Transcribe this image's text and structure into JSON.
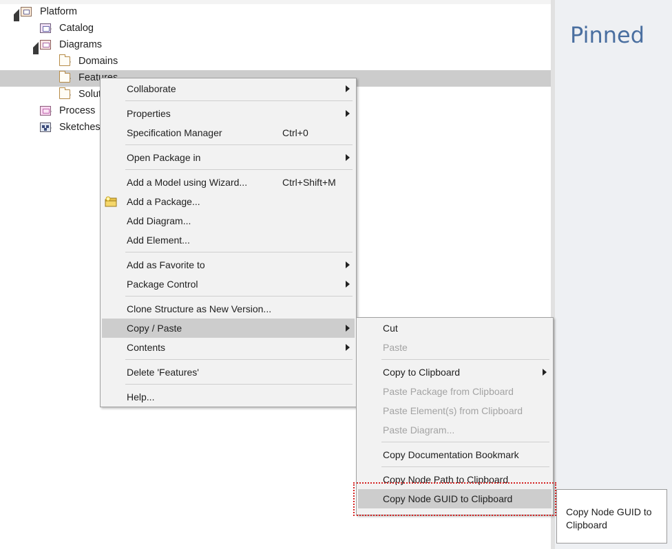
{
  "tree": {
    "items": [
      {
        "label": "Platform",
        "twisty": "open",
        "icon": "package-icon",
        "level": 0,
        "selected": false
      },
      {
        "label": "Catalog",
        "twisty": "closed",
        "icon": "catalog-package-icon",
        "level": 1,
        "selected": false
      },
      {
        "label": "Diagrams",
        "twisty": "open",
        "icon": "diagram-package-icon",
        "level": 1,
        "selected": false
      },
      {
        "label": "Domains",
        "twisty": "closed",
        "icon": "folder-icon",
        "level": 2,
        "selected": false
      },
      {
        "label": "Features",
        "twisty": "closed",
        "icon": "folder-icon",
        "level": 2,
        "selected": true
      },
      {
        "label": "Solutions",
        "twisty": "closed",
        "icon": "folder-icon",
        "level": 2,
        "selected": false
      },
      {
        "label": "Process",
        "twisty": "closed",
        "icon": "process-package-icon",
        "level": 1,
        "selected": false
      },
      {
        "label": "Sketches",
        "twisty": "closed",
        "icon": "sketch-package-icon",
        "level": 1,
        "selected": false
      }
    ]
  },
  "pinned": {
    "title": "Pinned"
  },
  "context_menu": {
    "items": [
      {
        "label": "Collaborate",
        "submenu": true
      },
      {
        "separator": true
      },
      {
        "label": "Properties",
        "submenu": true
      },
      {
        "label": "Specification Manager",
        "shortcut": "Ctrl+0"
      },
      {
        "separator": true
      },
      {
        "label": "Open Package in",
        "submenu": true
      },
      {
        "separator": true
      },
      {
        "label": "Add a Model using Wizard...",
        "shortcut": "Ctrl+Shift+M"
      },
      {
        "label": "Add a Package...",
        "icon": "add-package-icon"
      },
      {
        "label": "Add Diagram..."
      },
      {
        "label": "Add Element..."
      },
      {
        "separator": true
      },
      {
        "label": "Add as Favorite to",
        "submenu": true
      },
      {
        "label": "Package Control",
        "submenu": true
      },
      {
        "separator": true
      },
      {
        "label": "Clone Structure as New Version..."
      },
      {
        "label": "Copy / Paste",
        "submenu": true,
        "highlighted": true
      },
      {
        "label": "Contents",
        "submenu": true
      },
      {
        "separator": true
      },
      {
        "label": "Delete 'Features'"
      },
      {
        "separator": true
      },
      {
        "label": "Help..."
      }
    ]
  },
  "copy_paste_menu": {
    "items": [
      {
        "label": "Cut"
      },
      {
        "label": "Paste",
        "disabled": true
      },
      {
        "separator": true
      },
      {
        "label": "Copy to Clipboard",
        "submenu": true
      },
      {
        "label": "Paste Package from Clipboard",
        "disabled": true
      },
      {
        "label": "Paste Element(s) from Clipboard",
        "disabled": true
      },
      {
        "label": "Paste Diagram...",
        "disabled": true
      },
      {
        "separator": true
      },
      {
        "label": "Copy Documentation Bookmark"
      },
      {
        "separator": true
      },
      {
        "label": "Copy Node Path to Clipboard"
      },
      {
        "label": "Copy Node GUID to Clipboard",
        "highlighted": true
      }
    ]
  },
  "tooltip": {
    "text": "Copy Node GUID to Clipboard"
  },
  "colors": {
    "selection": "#cccccc",
    "menu_background": "#f2f2f2",
    "menu_highlight": "#cdcdcd",
    "disabled_text": "#a3a3a3",
    "pinned_title": "#4a6fa0",
    "focus_outline": "#d42020"
  }
}
